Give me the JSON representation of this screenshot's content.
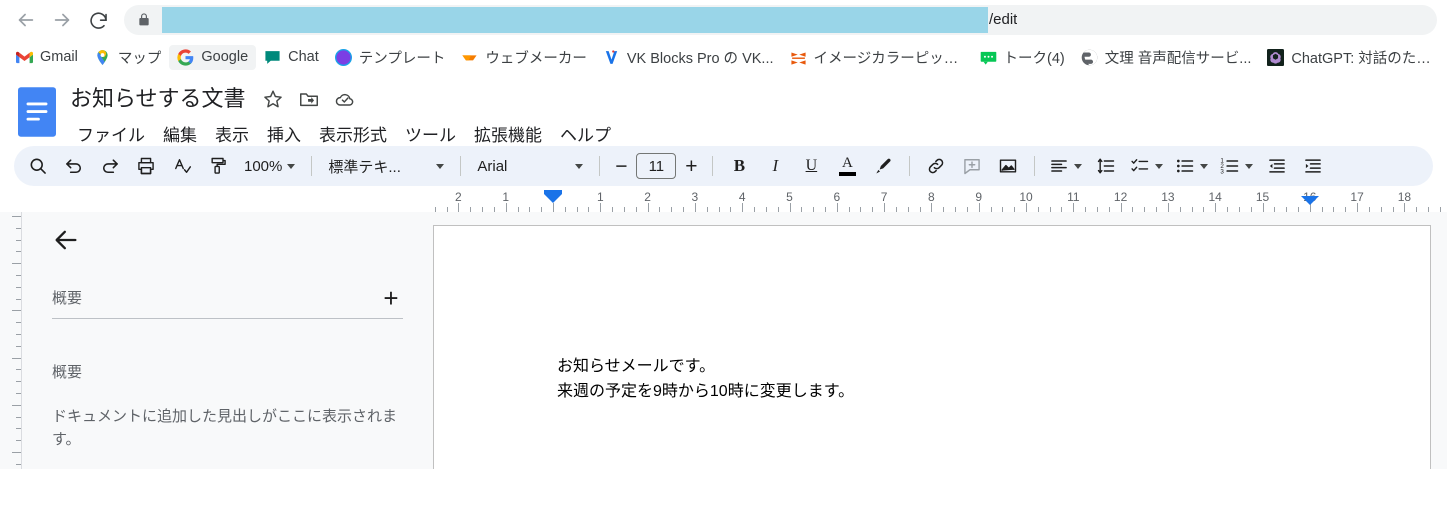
{
  "browser": {
    "nav": {
      "back_label": "戻る",
      "forward_label": "進む",
      "reload_label": "再読み込み"
    },
    "omnibox": {
      "lock_icon": "lock-icon",
      "url_redacted": "",
      "url_tail": "/edit"
    },
    "bookmarks": [
      {
        "label": "Gmail",
        "icon": "gmail-icon"
      },
      {
        "label": "マップ",
        "icon": "google-maps-icon"
      },
      {
        "label": "Google",
        "icon": "google-g-icon"
      },
      {
        "label": "Chat",
        "icon": "google-chat-icon"
      },
      {
        "label": "テンプレート",
        "icon": "template-icon"
      },
      {
        "label": "ウェブメーカー",
        "icon": "webmaker-icon"
      },
      {
        "label": "VK Blocks Pro の VK...",
        "icon": "vk-blocks-icon"
      },
      {
        "label": "イメージカラーピッカー |...",
        "icon": "image-color-picker-icon"
      },
      {
        "label": "トーク(4)",
        "icon": "talk-icon"
      },
      {
        "label": "文理 音声配信サービ...",
        "icon": "bunri-audio-icon"
      },
      {
        "label": "ChatGPT: 対話のため...",
        "icon": "chatgpt-icon"
      }
    ]
  },
  "docs": {
    "app_icon": "google-docs-icon",
    "title": "お知らせする文書",
    "title_actions": [
      {
        "name": "star-icon",
        "label": "スターを付ける"
      },
      {
        "name": "move-to-folder-icon",
        "label": "移動"
      },
      {
        "name": "cloud-saved-icon",
        "label": "ドライブに保存しました"
      }
    ],
    "menus": [
      "ファイル",
      "編集",
      "表示",
      "挿入",
      "表示形式",
      "ツール",
      "拡張機能",
      "ヘルプ"
    ],
    "toolbar": {
      "search_label": "検索",
      "undo_label": "元に戻す",
      "redo_label": "やり直し",
      "print_label": "印刷",
      "spellcheck_label": "スペルと文法のチェック",
      "paint_format_label": "書式を貼り付け",
      "zoom_value": "100%",
      "style_value": "標準テキ...",
      "font_value": "Arial",
      "font_size_decrease": "−",
      "font_size_value": "11",
      "font_size_increase": "+",
      "bold_label": "B",
      "italic_label": "I",
      "underline_label": "U",
      "text_color_label": "A",
      "highlight_label": "ハイライト",
      "link_label": "リンクを挿入",
      "comment_label": "コメントを追加",
      "image_label": "画像を挿入",
      "align_label": "配置",
      "line_spacing_label": "行間隔",
      "checklist_label": "チェックリスト",
      "bulleted_list_label": "箇条書き",
      "numbered_list_label": "番号付きリスト",
      "decrease_indent_label": "インデント減",
      "increase_indent_label": "インデント増"
    },
    "ruler": {
      "numbers": [
        "2",
        "1",
        "1",
        "2",
        "3",
        "4",
        "5",
        "6",
        "7",
        "8",
        "9",
        "10",
        "11",
        "12",
        "13",
        "14",
        "15",
        "16",
        "17",
        "18"
      ],
      "left_indent_value": "0",
      "right_indent_value": "16"
    },
    "outline": {
      "back_label": "戻る",
      "title": "概要",
      "add_label": "+",
      "section_title": "概要",
      "empty_text": "ドキュメントに追加した見出しがここに表示されます。"
    },
    "document": {
      "lines": [
        "お知らせメールです。",
        "来週の予定を9時から10時に変更します。"
      ]
    }
  },
  "colors": {
    "accent_blue": "#1a73e8",
    "toolbar_bg": "#edf2fa",
    "canvas_bg": "#f8f9fa",
    "url_selection": "#99d5e8",
    "docs_blue": "#4285f4"
  }
}
